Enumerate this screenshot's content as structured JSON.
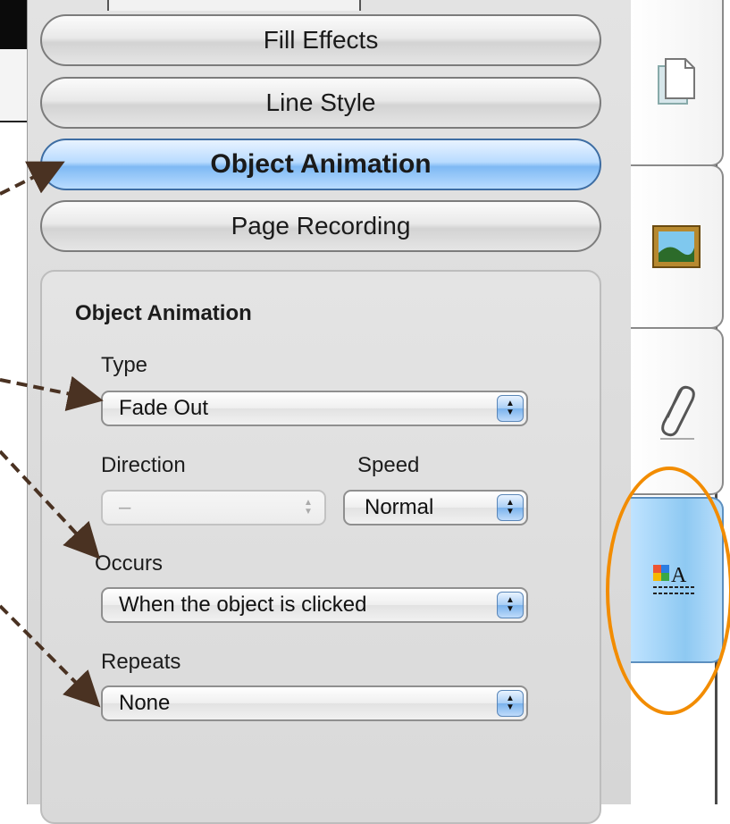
{
  "buttons": {
    "fill_effects": "Fill Effects",
    "line_style": "Line Style",
    "object_animation": "Object Animation",
    "page_recording": "Page Recording"
  },
  "group": {
    "title": "Object Animation",
    "type_label": "Type",
    "type_value": "Fade Out",
    "direction_label": "Direction",
    "direction_value": "–",
    "speed_label": "Speed",
    "speed_value": "Normal",
    "occurs_label": "Occurs",
    "occurs_value": "When the object is clicked",
    "repeats_label": "Repeats",
    "repeats_value": "None"
  },
  "tabs": [
    {
      "icon": "pages-icon"
    },
    {
      "icon": "picture-icon"
    },
    {
      "icon": "paperclip-icon"
    },
    {
      "icon": "properties-icon",
      "active": true
    }
  ],
  "colors": {
    "active_button": "#7fb9f4",
    "highlight_ring": "#f28c00",
    "annotation_arrow": "#4a3222"
  }
}
